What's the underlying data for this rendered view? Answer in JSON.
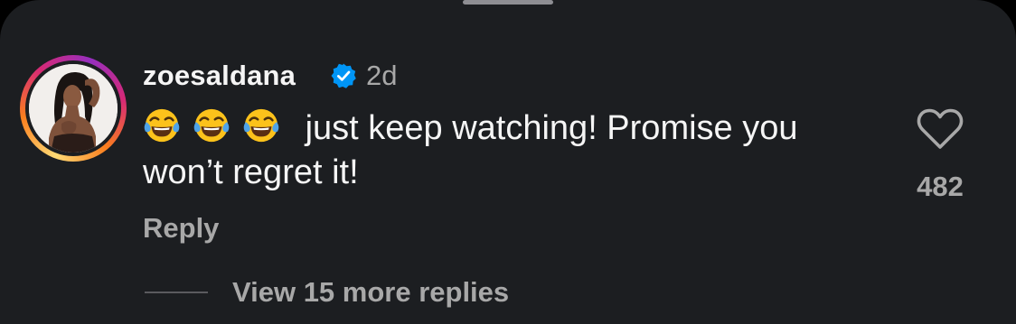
{
  "comment": {
    "username": "zoesaldana",
    "timestamp": "2d",
    "emojis": [
      "face-with-tears-of-joy",
      "face-with-tears-of-joy",
      "face-with-tears-of-joy"
    ],
    "text": "just keep watching! Promise you won’t regret it!",
    "reply_label": "Reply",
    "like_count": "482",
    "view_replies_label": "View 15 more replies"
  },
  "colors": {
    "sheet_background": "#1c1e21",
    "primary_text": "#f5f5f5",
    "secondary_text": "#a8a8a8",
    "verified_badge": "#0095f6"
  },
  "icons": {
    "verified": "verified-badge-icon",
    "like": "heart-outline-icon"
  }
}
